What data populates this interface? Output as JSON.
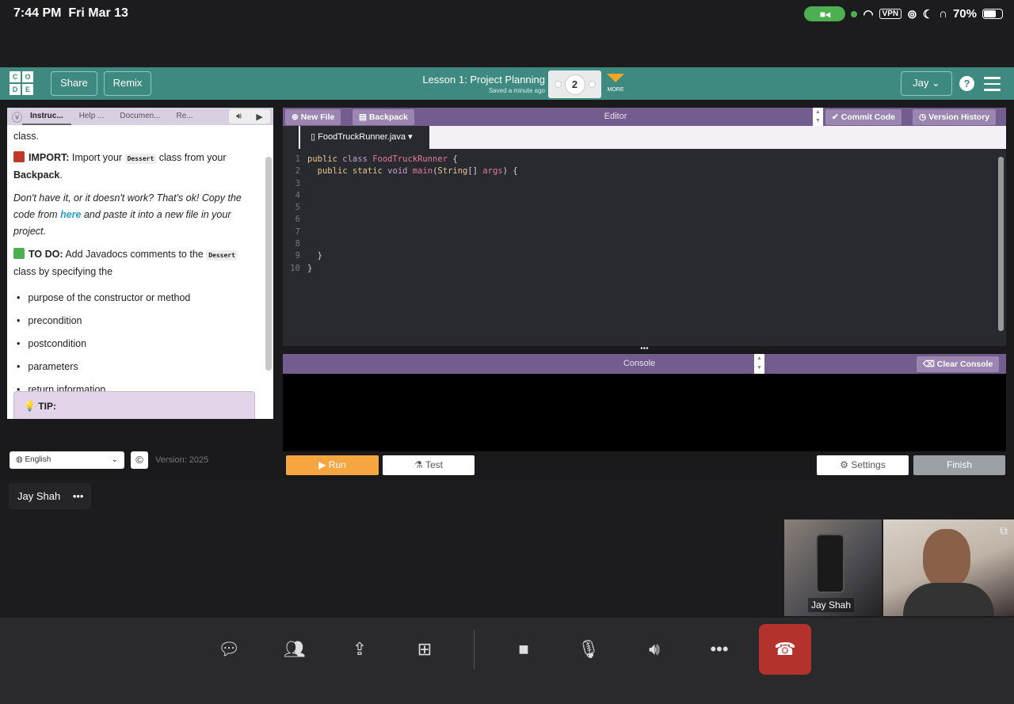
{
  "status_bar": {
    "time": "7:44 PM",
    "date": "Fri Mar 13",
    "vpn": "VPN",
    "battery": "70%",
    "battery_level": 0.7
  },
  "header": {
    "logo": [
      "C",
      "O",
      "D",
      "E"
    ],
    "share": "Share",
    "remix": "Remix",
    "title": "Lesson 1: Project Planning",
    "saved": "Saved a minute ago",
    "level": "2",
    "more": "MORE",
    "user": "Jay",
    "help": "?",
    "accent": "#3e8a80"
  },
  "instructions": {
    "tabs": [
      "Instruc...",
      "Help ...",
      "Documen...",
      "Re..."
    ],
    "line0": "class.",
    "import_label": "IMPORT:",
    "import_text1": "Import your",
    "import_code": "Dessert",
    "import_text2": "class from your",
    "import_text3": "Backpack",
    "italic1": "Don't have it, or it doesn't work? That's ok! Copy the code from",
    "link": "here",
    "italic2": "and paste it into a new file in your project.",
    "todo_label": "TO DO:",
    "todo_text1": "Add Javadocs comments to the",
    "todo_code": "Dessert",
    "todo_text2": "class by specifying the",
    "bullets": [
      "purpose of the constructor or method",
      "precondition",
      "postcondition",
      "parameters",
      "return information"
    ],
    "tip": "TIP:"
  },
  "editor": {
    "new_file": "New File",
    "backpack": "Backpack",
    "title": "Editor",
    "commit": "Commit Code",
    "history": "Version History",
    "file_tab": "FoodTruckRunner.java",
    "line_numbers": [
      "1",
      "2",
      "3",
      "4",
      "5",
      "6",
      "7",
      "8",
      "9",
      "10"
    ]
  },
  "console": {
    "title": "Console",
    "clear": "Clear Console"
  },
  "actions": {
    "run": "Run",
    "test": "Test",
    "settings": "Settings",
    "finish": "Finish"
  },
  "footer": {
    "language": "English",
    "copyright": "©",
    "version": "Version: 2025"
  },
  "call": {
    "participant": "Jay Shah",
    "tile_label": "Jay Shah",
    "more": "•••"
  }
}
